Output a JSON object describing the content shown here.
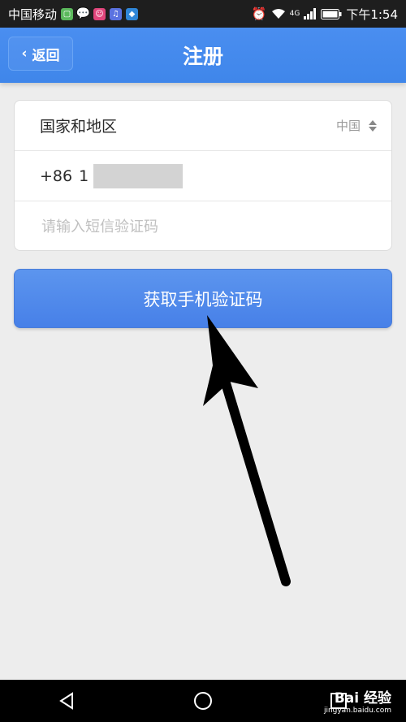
{
  "status_bar": {
    "carrier": "中国移动",
    "signal": "4G",
    "time": "下午1:54"
  },
  "header": {
    "back_label": "返回",
    "title": "注册"
  },
  "form": {
    "region_label": "国家和地区",
    "region_value": "中国",
    "phone_prefix": "+86",
    "phone_value": "1",
    "sms_placeholder": "请输入短信验证码"
  },
  "primary_button": {
    "label": "获取手机验证码"
  },
  "watermark": {
    "brand": "Bai 经验",
    "url": "jingyan.baidu.com"
  },
  "colors": {
    "header": "#3f86ea",
    "button": "#4f89ea",
    "background": "#ededed"
  }
}
